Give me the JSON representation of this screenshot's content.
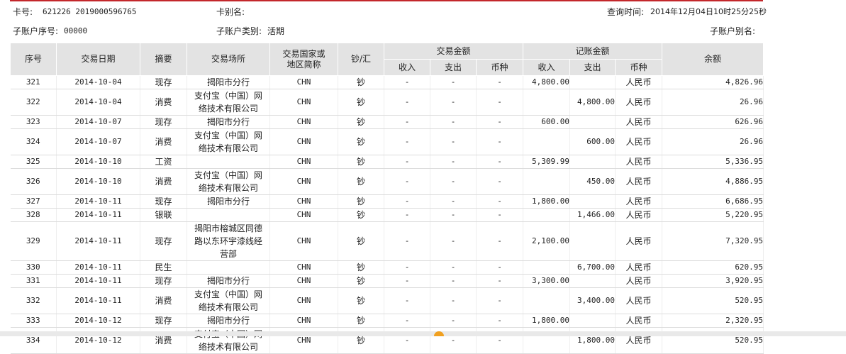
{
  "header": {
    "card_no_label": "卡号:",
    "card_no": "621226 2019000596765",
    "card_alias_label": "卡别名:",
    "query_time_label": "查询时间:",
    "query_time": "2014年12月04日10时25分25秒",
    "sub_no_label": "子账户序号:",
    "sub_no": "00000",
    "sub_type_label": "子账户类别:",
    "sub_type": "活期",
    "sub_alias_label": "子账户别名:"
  },
  "columns": {
    "seq": "序号",
    "date": "交易日期",
    "summary": "摘要",
    "place": "交易场所",
    "country": "交易国家或地区简称",
    "cash": "钞/汇",
    "trade_amount": "交易金额",
    "book_amount": "记账金额",
    "income": "收入",
    "expense": "支出",
    "currency": "币种",
    "balance": "余额"
  },
  "rows": [
    {
      "seq": "321",
      "date": "2014-10-04",
      "summary": "现存",
      "place": "揭阳市分行",
      "country": "CHN",
      "cash": "钞",
      "t_in": "-",
      "t_out": "-",
      "t_cur": "-",
      "b_in": "4,800.00",
      "b_out": "",
      "b_cur": "人民币",
      "balance": "4,826.96"
    },
    {
      "seq": "322",
      "date": "2014-10-04",
      "summary": "消费",
      "place": "支付宝（中国）网络技术有限公司",
      "country": "CHN",
      "cash": "钞",
      "t_in": "-",
      "t_out": "-",
      "t_cur": "-",
      "b_in": "",
      "b_out": "4,800.00",
      "b_cur": "人民币",
      "balance": "26.96"
    },
    {
      "seq": "323",
      "date": "2014-10-07",
      "summary": "现存",
      "place": "揭阳市分行",
      "country": "CHN",
      "cash": "钞",
      "t_in": "-",
      "t_out": "-",
      "t_cur": "-",
      "b_in": "600.00",
      "b_out": "",
      "b_cur": "人民币",
      "balance": "626.96"
    },
    {
      "seq": "324",
      "date": "2014-10-07",
      "summary": "消费",
      "place": "支付宝（中国）网络技术有限公司",
      "country": "CHN",
      "cash": "钞",
      "t_in": "-",
      "t_out": "-",
      "t_cur": "-",
      "b_in": "",
      "b_out": "600.00",
      "b_cur": "人民币",
      "balance": "26.96"
    },
    {
      "seq": "325",
      "date": "2014-10-10",
      "summary": "工资",
      "place": "",
      "country": "CHN",
      "cash": "钞",
      "t_in": "-",
      "t_out": "-",
      "t_cur": "-",
      "b_in": "5,309.99",
      "b_out": "",
      "b_cur": "人民币",
      "balance": "5,336.95"
    },
    {
      "seq": "326",
      "date": "2014-10-10",
      "summary": "消费",
      "place": "支付宝（中国）网络技术有限公司",
      "country": "CHN",
      "cash": "钞",
      "t_in": "-",
      "t_out": "-",
      "t_cur": "-",
      "b_in": "",
      "b_out": "450.00",
      "b_cur": "人民币",
      "balance": "4,886.95"
    },
    {
      "seq": "327",
      "date": "2014-10-11",
      "summary": "现存",
      "place": "揭阳市分行",
      "country": "CHN",
      "cash": "钞",
      "t_in": "-",
      "t_out": "-",
      "t_cur": "-",
      "b_in": "1,800.00",
      "b_out": "",
      "b_cur": "人民币",
      "balance": "6,686.95"
    },
    {
      "seq": "328",
      "date": "2014-10-11",
      "summary": "银联",
      "place": "",
      "country": "CHN",
      "cash": "钞",
      "t_in": "-",
      "t_out": "-",
      "t_cur": "-",
      "b_in": "",
      "b_out": "1,466.00",
      "b_cur": "人民币",
      "balance": "5,220.95"
    },
    {
      "seq": "329",
      "date": "2014-10-11",
      "summary": "现存",
      "place": "揭阳市榕城区同德路以东环宇漆线经营部",
      "country": "CHN",
      "cash": "钞",
      "t_in": "-",
      "t_out": "-",
      "t_cur": "-",
      "b_in": "2,100.00",
      "b_out": "",
      "b_cur": "人民币",
      "balance": "7,320.95"
    },
    {
      "seq": "330",
      "date": "2014-10-11",
      "summary": "民生",
      "place": "",
      "country": "CHN",
      "cash": "钞",
      "t_in": "-",
      "t_out": "-",
      "t_cur": "-",
      "b_in": "",
      "b_out": "6,700.00",
      "b_cur": "人民币",
      "balance": "620.95"
    },
    {
      "seq": "331",
      "date": "2014-10-11",
      "summary": "现存",
      "place": "揭阳市分行",
      "country": "CHN",
      "cash": "钞",
      "t_in": "-",
      "t_out": "-",
      "t_cur": "-",
      "b_in": "3,300.00",
      "b_out": "",
      "b_cur": "人民币",
      "balance": "3,920.95"
    },
    {
      "seq": "332",
      "date": "2014-10-11",
      "summary": "消费",
      "place": "支付宝（中国）网络技术有限公司",
      "country": "CHN",
      "cash": "钞",
      "t_in": "-",
      "t_out": "-",
      "t_cur": "-",
      "b_in": "",
      "b_out": "3,400.00",
      "b_cur": "人民币",
      "balance": "520.95"
    },
    {
      "seq": "333",
      "date": "2014-10-12",
      "summary": "现存",
      "place": "揭阳市分行",
      "country": "CHN",
      "cash": "钞",
      "t_in": "-",
      "t_out": "-",
      "t_cur": "-",
      "b_in": "1,800.00",
      "b_out": "",
      "b_cur": "人民币",
      "balance": "2,320.95"
    },
    {
      "seq": "334",
      "date": "2014-10-12",
      "summary": "消费",
      "place": "支付宝（中国）网络技术有限公司",
      "country": "CHN",
      "cash": "钞",
      "t_in": "-",
      "t_out": "-",
      "t_cur": "-",
      "b_in": "",
      "b_out": "1,800.00",
      "b_cur": "人民币",
      "balance": "520.95"
    }
  ]
}
